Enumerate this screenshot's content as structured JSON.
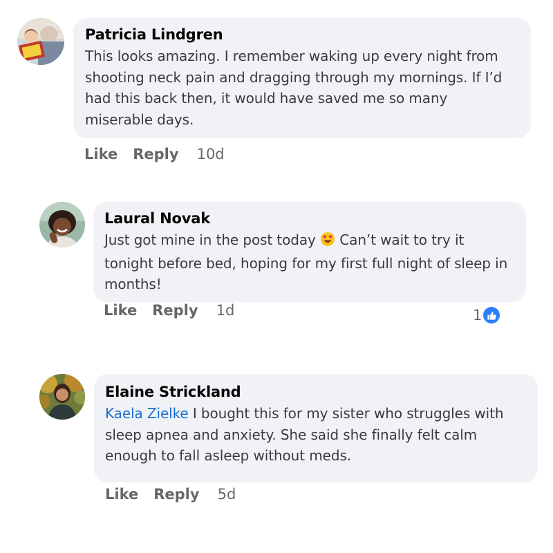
{
  "comments": [
    {
      "author": "Patricia Lindgren",
      "text": "This looks amazing. I remember waking up every night from shooting neck pain and dragging through my mornings. If I’d had this back then, it would have saved me so many miserable days.",
      "like_label": "Like",
      "reply_label": "Reply",
      "time": "10d"
    },
    {
      "author": "Laural Novak",
      "text_before_emoji": "Just got mine in the post today ",
      "emoji": "heart-eyes-emoji",
      "text_after_emoji": " Can’t wait to try it tonight before bed, hoping for my first full night of sleep in months!",
      "like_label": "Like",
      "reply_label": "Reply",
      "time": "1d",
      "reaction_count": "1",
      "reaction_icon": "like-icon"
    },
    {
      "author": "Elaine Strickland",
      "mention": "Kaela Zielke",
      "text": " I bought this for my sister who struggles with sleep apnea and anxiety. She said she finally felt calm enough to fall asleep without meds.",
      "like_label": "Like",
      "reply_label": "Reply",
      "time": "5d"
    }
  ],
  "colors": {
    "bubble": "#f0f2f5",
    "author": "#050505",
    "text": "#3a3b3c",
    "meta": "#65676b",
    "mention": "#1b6fd6",
    "like_badge": "#2d7ff9"
  }
}
